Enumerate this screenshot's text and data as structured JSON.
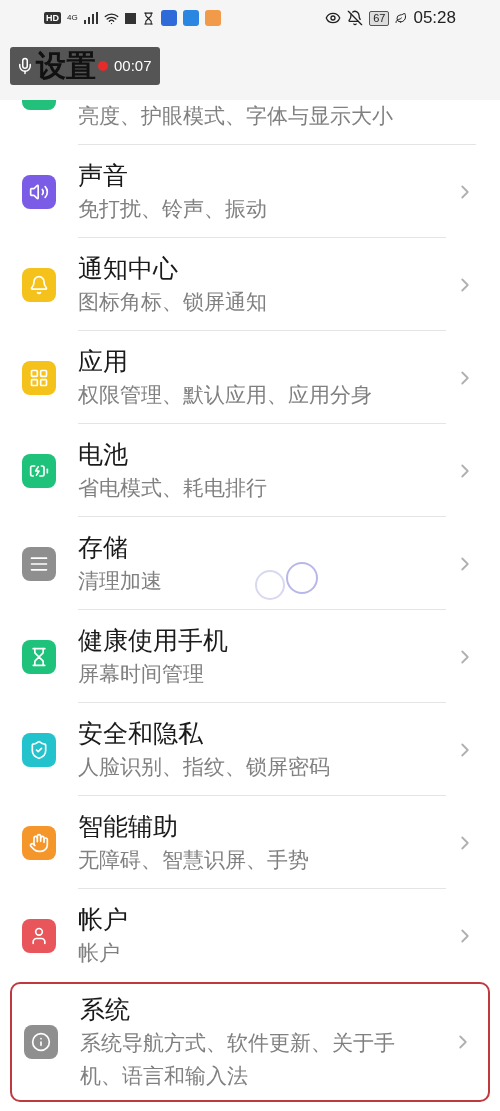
{
  "status_bar": {
    "hd": "HD",
    "network": "4G",
    "battery": "67",
    "time": "05:28"
  },
  "header": {
    "title": "设置"
  },
  "recorder": {
    "time": "00:07",
    "recording": true
  },
  "partial_row": {
    "subtitle": "亮度、护眼模式、字体与显示大小",
    "color": "#22c07a"
  },
  "rows": [
    {
      "title": "声音",
      "subtitle": "免打扰、铃声、振动",
      "color": "#7a5ce6",
      "highlighted": false
    },
    {
      "title": "通知中心",
      "subtitle": "图标角标、锁屏通知",
      "color": "#f5c21b",
      "highlighted": false
    },
    {
      "title": "应用",
      "subtitle": "权限管理、默认应用、应用分身",
      "color": "#f5c21b",
      "highlighted": false
    },
    {
      "title": "电池",
      "subtitle": "省电模式、耗电排行",
      "color": "#1fc27a",
      "highlighted": false
    },
    {
      "title": "存储",
      "subtitle": "清理加速",
      "color": "#8f8f8f",
      "highlighted": false
    },
    {
      "title": "健康使用手机",
      "subtitle": "屏幕时间管理",
      "color": "#1fc27a",
      "highlighted": false
    },
    {
      "title": "安全和隐私",
      "subtitle": "人脸识别、指纹、锁屏密码",
      "color": "#22c3cc",
      "highlighted": false
    },
    {
      "title": "智能辅助",
      "subtitle": "无障碍、智慧识屏、手势",
      "color": "#f5962a",
      "highlighted": false
    },
    {
      "title": "帐户",
      "subtitle": "帐户",
      "color": "#e8555a",
      "highlighted": false
    },
    {
      "title": "系统",
      "subtitle": "系统导航方式、软件更新、关于手机、语言和输入法",
      "color": "#8f8f8f",
      "highlighted": true
    }
  ]
}
